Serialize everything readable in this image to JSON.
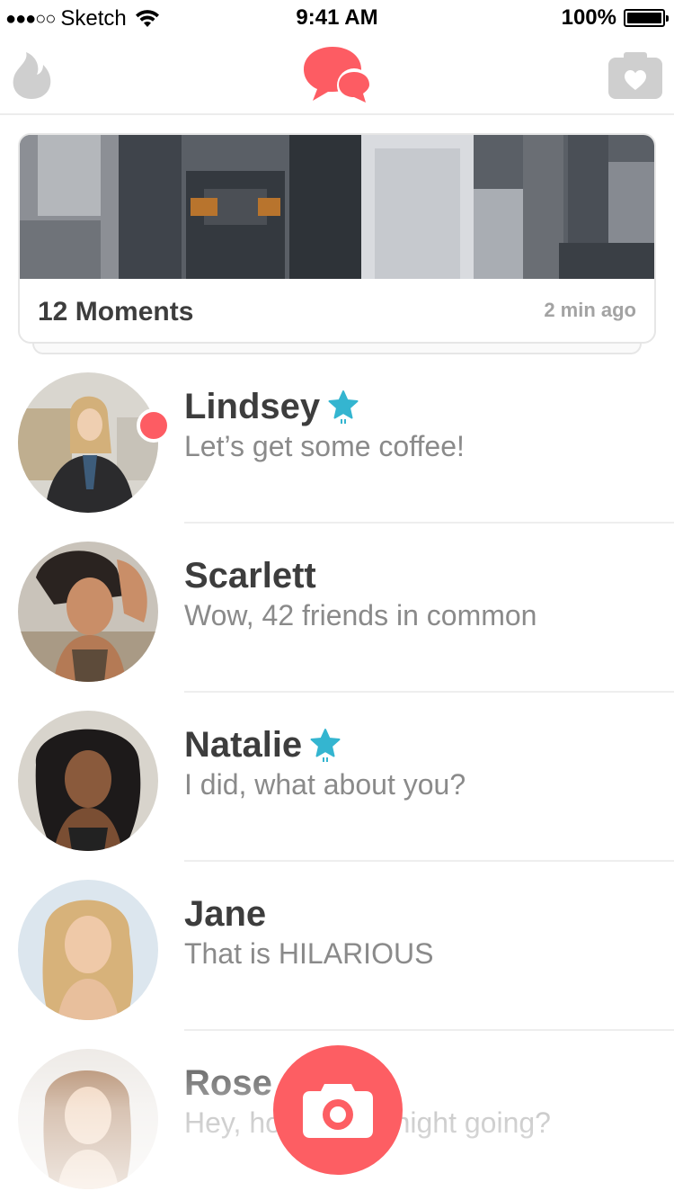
{
  "status_bar": {
    "signal": "●●●○○",
    "carrier": "Sketch",
    "time": "9:41 AM",
    "battery": "100%",
    "battery_level": 1.0,
    "icons": [
      "wifi-icon",
      "battery-icon"
    ]
  },
  "nav": {
    "left_icon": "flame-icon",
    "center_icon": "chat-bubbles-icon",
    "right_icon": "moments-heart-icon"
  },
  "moments": {
    "label": "12 Moments",
    "time": "2 min ago"
  },
  "messages": [
    {
      "name": "Lindsey",
      "preview": "Let’s get some coffee!",
      "verified": true,
      "unread": true
    },
    {
      "name": "Scarlett",
      "preview": "Wow, 42 friends in common",
      "verified": false,
      "unread": false
    },
    {
      "name": "Natalie",
      "preview": "I did, what about you?",
      "verified": true,
      "unread": false
    },
    {
      "name": "Jane",
      "preview": "That is HILARIOUS",
      "verified": false,
      "unread": false
    },
    {
      "name": "Rose",
      "preview": "Hey, how’s your night going?",
      "verified": false,
      "unread": false
    }
  ],
  "fab": {
    "icon": "camera-icon"
  },
  "colors": {
    "accent": "#fd5c63",
    "star": "#34b5d0",
    "nav_gray": "#cfcfcf",
    "title_text": "#3d3d3d",
    "preview_text": "#8a8a8a"
  }
}
